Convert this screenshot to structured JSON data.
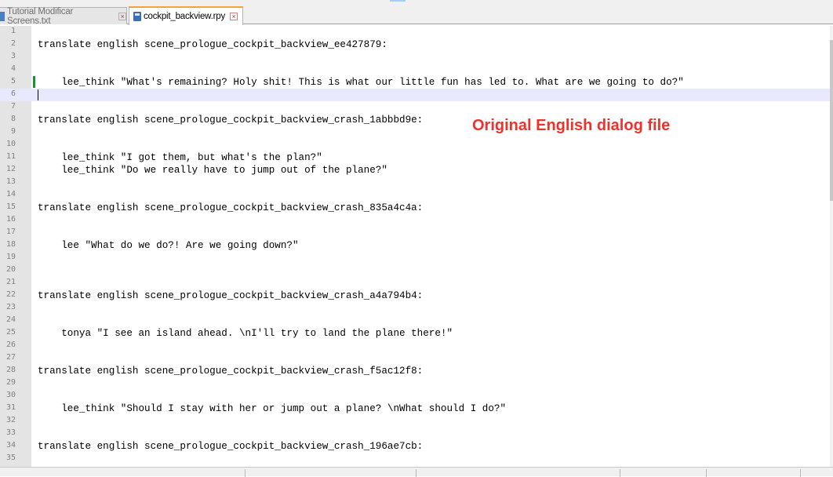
{
  "tabs": [
    {
      "label": "Tutorial Modificar Screens.txt",
      "close_label": "×",
      "active": false
    },
    {
      "label": "cockpit_backview.rpy",
      "close_label": "×",
      "active": true
    }
  ],
  "annotation": "Original English dialog file",
  "colors": {
    "annotation": "#f0322d",
    "current_line": "#e8e8ff",
    "active_tab_accent": "#f6a13a",
    "change_marker": "#1f8f2f",
    "gutter": "#e4e4e4"
  },
  "editor": {
    "current_line": 6,
    "changed_line": 5,
    "lines": [
      {
        "n": "1",
        "text": ""
      },
      {
        "n": "2",
        "text": "translate english scene_prologue_cockpit_backview_ee427879:"
      },
      {
        "n": "3",
        "text": ""
      },
      {
        "n": "4",
        "text": ""
      },
      {
        "n": "5",
        "text": "    lee_think \"What's remaining? Holy shit! This is what our little fun has led to. What are we going to do?\""
      },
      {
        "n": "6",
        "text": ""
      },
      {
        "n": "7",
        "text": ""
      },
      {
        "n": "8",
        "text": "translate english scene_prologue_cockpit_backview_crash_1abbbd9e:"
      },
      {
        "n": "9",
        "text": ""
      },
      {
        "n": "10",
        "text": ""
      },
      {
        "n": "11",
        "text": "    lee_think \"I got them, but what's the plan?\""
      },
      {
        "n": "12",
        "text": "    lee_think \"Do we really have to jump out of the plane?\""
      },
      {
        "n": "13",
        "text": ""
      },
      {
        "n": "14",
        "text": ""
      },
      {
        "n": "15",
        "text": "translate english scene_prologue_cockpit_backview_crash_835a4c4a:"
      },
      {
        "n": "16",
        "text": ""
      },
      {
        "n": "17",
        "text": ""
      },
      {
        "n": "18",
        "text": "    lee \"What do we do?! Are we going down?\""
      },
      {
        "n": "19",
        "text": ""
      },
      {
        "n": "20",
        "text": ""
      },
      {
        "n": "21",
        "text": ""
      },
      {
        "n": "22",
        "text": "translate english scene_prologue_cockpit_backview_crash_a4a794b4:"
      },
      {
        "n": "23",
        "text": ""
      },
      {
        "n": "24",
        "text": ""
      },
      {
        "n": "25",
        "text": "    tonya \"I see an island ahead. \\nI'll try to land the plane there!\""
      },
      {
        "n": "26",
        "text": ""
      },
      {
        "n": "27",
        "text": ""
      },
      {
        "n": "28",
        "text": "translate english scene_prologue_cockpit_backview_crash_f5ac12f8:"
      },
      {
        "n": "29",
        "text": ""
      },
      {
        "n": "30",
        "text": ""
      },
      {
        "n": "31",
        "text": "    lee_think \"Should I stay with her or jump out a plane? \\nWhat should I do?\""
      },
      {
        "n": "32",
        "text": ""
      },
      {
        "n": "33",
        "text": ""
      },
      {
        "n": "34",
        "text": "translate english scene_prologue_cockpit_backview_crash_196ae7cb:"
      },
      {
        "n": "35",
        "text": ""
      }
    ]
  }
}
